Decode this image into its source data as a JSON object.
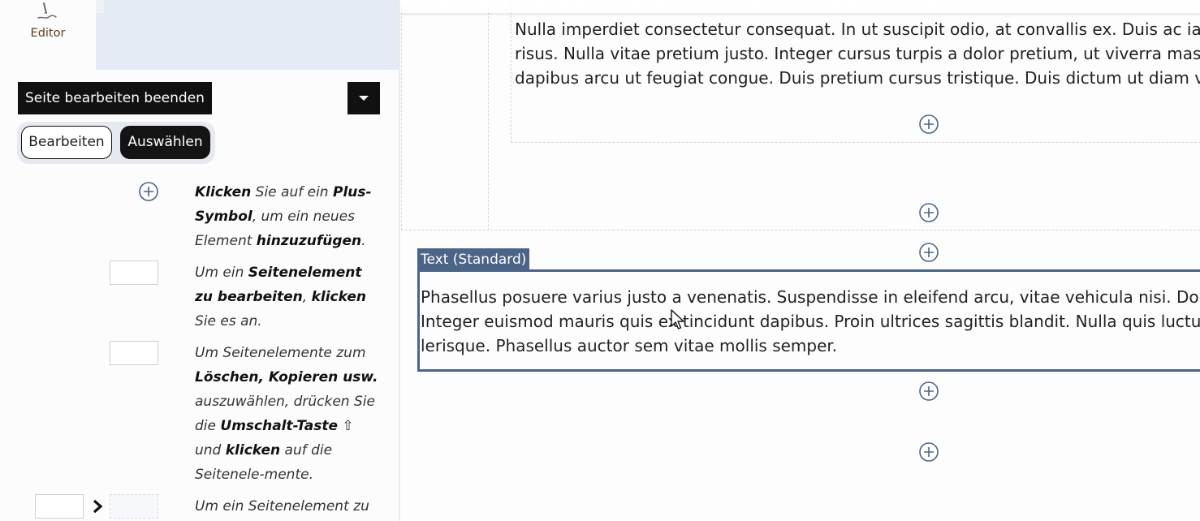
{
  "sidebar": {
    "tab_editor_label": "Editor",
    "exit_button_label": "Seite bearbeiten beenden",
    "mode_edit_label": "Bearbeiten",
    "mode_select_label": "Auswählen",
    "help": [
      {
        "parts": [
          {
            "text": "Klicken",
            "bold": true
          },
          {
            "text": " Sie auf ein ",
            "bold": false
          },
          {
            "text": "Plus-Symbol",
            "bold": true
          },
          {
            "text": ", um ein neues Element ",
            "bold": false
          },
          {
            "text": "hinzuzufügen",
            "bold": true
          },
          {
            "text": ".",
            "bold": false
          }
        ]
      },
      {
        "parts": [
          {
            "text": "Um ein ",
            "bold": false
          },
          {
            "text": "Seitenelement zu bearbeiten",
            "bold": true
          },
          {
            "text": ", ",
            "bold": false
          },
          {
            "text": "klicken",
            "bold": true
          },
          {
            "text": " Sie es an.",
            "bold": false
          }
        ]
      },
      {
        "parts": [
          {
            "text": "Um Seitenelemente zum ",
            "bold": false
          },
          {
            "text": "Löschen, Kopieren usw.",
            "bold": true
          },
          {
            "text": " auszuwählen, drücken Sie die ",
            "bold": false
          },
          {
            "text": "Umschalt-Taste",
            "bold": true
          },
          {
            "text": " ⇧ und ",
            "bold": false
          },
          {
            "text": "klicken",
            "bold": true
          },
          {
            "text": " auf die Seitenele-mente.",
            "bold": false
          }
        ]
      },
      {
        "parts": [
          {
            "text": "Um ein Seitenelement zu",
            "bold": false
          }
        ]
      }
    ]
  },
  "canvas": {
    "top_paragraph_lines": [
      "Nulla imperdiet consectetur consequat. In ut suscipit odio, at convallis ex. Duis ac iaculis",
      "risus. Nulla vitae pretium justo. Integer cursus turpis a dolor pretium, ut viverra massa",
      "dapibus arcu ut feugiat congue. Duis pretium cursus tristique. Duis dictum ut diam vel"
    ],
    "text_element_label": "Text (Standard)",
    "text_element_lines": [
      "Phasellus posuere varius justo a venenatis. Suspendisse in eleifend arcu, vitae vehicula nisi. Donec",
      "Integer euismod mauris quis ex tincidunt dapibus. Proin ultrices sagittis blandit. Nulla quis luctus li",
      "lerisque. Phasellus auctor sem vitae mollis semper."
    ]
  },
  "colors": {
    "accent_frame": "#4b6487",
    "dark_button": "#111111",
    "tab_highlight": "#e4ebf5",
    "plus_icon": "#4b6487"
  },
  "icons": {
    "editor_tab": "signature-pen-icon",
    "dropdown": "caret-down-icon",
    "add": "plus-circle-icon",
    "arrow": "chevron-right-icon",
    "pointer": "mouse-cursor-icon"
  }
}
